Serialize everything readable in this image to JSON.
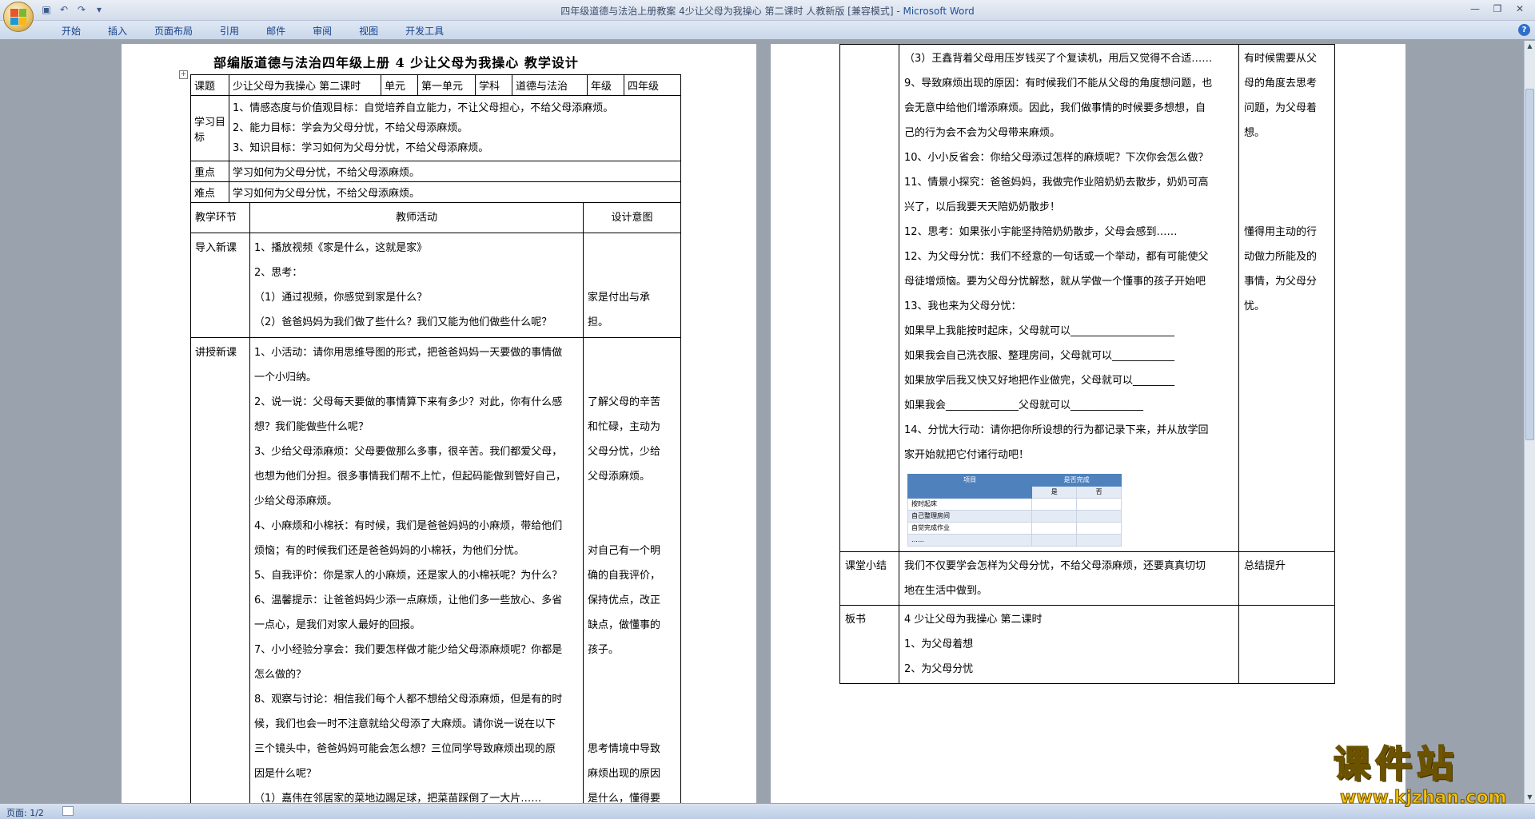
{
  "window": {
    "title": "四年级道德与法治上册教案 4少让父母为我操心  第二课时 人教新版 [兼容模式] - ",
    "app_name": "Microsoft Word"
  },
  "ribbon": {
    "tabs": [
      "开始",
      "插入",
      "页面布局",
      "引用",
      "邮件",
      "审阅",
      "视图",
      "开发工具"
    ]
  },
  "doc": {
    "title": "部编版道德与法治四年级上册    4 少让父母为我操心    教学设计",
    "header": {
      "topic_label": "课题",
      "topic_value": "少让父母为我操心 第二课时",
      "unit_label": "单元",
      "unit_value": "第一单元",
      "subject_label": "学科",
      "subject_value": "道德与法治",
      "grade_label": "年级",
      "grade_value": "四年级",
      "goals_label": "学习目标",
      "goals": [
        "1、情感态度与价值观目标：自觉培养自立能力，不让父母担心，不给父母添麻烦。",
        "2、能力目标：学会为父母分忧，不给父母添麻烦。",
        "3、知识目标：学习如何为父母分忧，不给父母添麻烦。"
      ],
      "key_label": "重点",
      "key_value": "学习如何为父母分忧，不给父母添麻烦。",
      "diff_label": "难点",
      "diff_value": "学习如何为父母分忧，不给父母添麻烦。"
    },
    "columns": [
      "教学环节",
      "教师活动",
      "设计意图"
    ],
    "intro": {
      "label": "导入新课",
      "lines": [
        "1、播放视频《家是什么，这就是家》",
        "2、思考：",
        "（1）通过视频，你感觉到家是什么？",
        "（2）爸爸妈妈为我们做了些什么？我们又能为他们做些什么呢？"
      ],
      "intent": [
        "",
        "",
        "家是付出与承",
        "担。"
      ]
    },
    "lecture": {
      "label": "讲授新课",
      "lines": [
        "1、小活动：请你用思维导图的形式，把爸爸妈妈一天要做的事情做",
        "一个小归纳。",
        "2、说一说：父母每天要做的事情算下来有多少？对此，你有什么感",
        "想？我们能做些什么呢？",
        "3、少给父母添麻烦：父母要做那么多事，很辛苦。我们都爱父母，",
        "也想为他们分担。很多事情我们帮不上忙，但起码能做到管好自己，",
        "少给父母添麻烦。",
        "4、小麻烦和小棉袄：有时候，我们是爸爸妈妈的小麻烦，带给他们",
        "烦恼；有的时候我们还是爸爸妈妈的小棉袄，为他们分忧。",
        "5、自我评价：你是家人的小麻烦，还是家人的小棉袄呢？为什么？",
        "6、温馨提示：让爸爸妈妈少添一点麻烦，让他们多一些放心、多省",
        "一点心，是我们对家人最好的回报。",
        "7、小小经验分享会：我们要怎样做才能少给父母添麻烦呢？你都是",
        "怎么做的？",
        "8、观察与讨论：相信我们每个人都不想给父母添麻烦，但是有的时",
        "候，我们也会一时不注意就给父母添了大麻烦。请你说一说在以下",
        "三个镜头中，爸爸妈妈可能会怎么想？三位同学导致麻烦出现的原",
        "因是什么呢？",
        "（1）嘉伟在邻居家的菜地边踢足球，把菜苗踩倒了一大片……"
      ],
      "intent": [
        "",
        "",
        "了解父母的辛苦",
        "和忙碌，主动为",
        "父母分忧，少给",
        "父母添麻烦。",
        "",
        "",
        "对自己有一个明",
        "确的自我评价，",
        "保持优点，改正",
        "缺点，做懂事的",
        "孩子。",
        "",
        "",
        "",
        "思考情境中导致",
        "麻烦出现的原因",
        "是什么，懂得要"
      ]
    },
    "page2": {
      "cont_lines": [
        "（3）王鑫背着父母用压岁钱买了个复读机，用后又觉得不合适……",
        "9、导致麻烦出现的原因：有时候我们不能从父母的角度想问题，也",
        "会无意中给他们增添麻烦。因此，我们做事情的时候要多想想，自",
        "己的行为会不会为父母带来麻烦。",
        "10、小小反省会：你给父母添过怎样的麻烦呢？下次你会怎么做？",
        "11、情景小探究：爸爸妈妈，我做完作业陪奶奶去散步，奶奶可高",
        "兴了，以后我要天天陪奶奶散步！",
        "12、思考：如果张小宇能坚持陪奶奶散步，父母会感到……",
        "12、为父母分忧：我们不经意的一句话或一个举动，都有可能使父",
        "母徒增烦恼。要为父母分忧解愁，就从学做一个懂事的孩子开始吧",
        "13、我也来为父母分忧：",
        "如果早上我能按时起床，父母就可以____________________",
        "如果我会自己洗衣服、整理房间，父母就可以____________",
        "如果放学后我又快又好地把作业做完，父母就可以________",
        "如果我会______________父母就可以______________",
        "14、分忧大行动：请你把你所设想的行为都记录下来，并从放学回",
        "家开始就把它付诸行动吧！"
      ],
      "cont_intent": [
        "有时候需要从父",
        "母的角度去思考",
        "问题，为父母着",
        "想。",
        "",
        "",
        "",
        "懂得用主动的行",
        "动做力所能及的",
        "事情，为父母分",
        "忧。",
        "",
        "",
        "",
        "",
        "",
        ""
      ],
      "mini_table": {
        "col_item": "项目",
        "col_done": "是否完成",
        "yes": "是",
        "no": "否",
        "rows": [
          "按时起床",
          "自己整理房间",
          "自觉完成作业",
          "……"
        ]
      },
      "summary_label": "课堂小结",
      "summary_lines": [
        "我们不仅要学会怎样为父母分忧，不给父母添麻烦，还要真真切切",
        "地在生活中做到。"
      ],
      "summary_intent": "总结提升",
      "board_label": "板书",
      "board_lines": [
        "4 少让父母为我操心    第二课时",
        "1、为父母着想",
        "2、为父母分忧"
      ]
    }
  },
  "status": {
    "page": "页面: 1/2"
  },
  "watermark": {
    "big": "课件站",
    "url": "www.kjzhan.com"
  },
  "colors": {
    "ribbon_text": "#15428b",
    "watermark": "#f4c00f",
    "mini_header": "#4f81bd"
  }
}
